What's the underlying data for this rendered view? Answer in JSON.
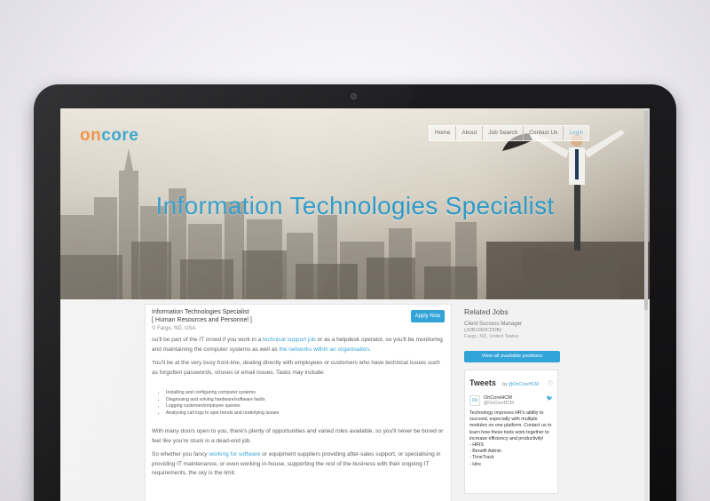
{
  "brand": {
    "logo_prefix": "on",
    "logo_rest": "core",
    "accent": "#2fa0c9",
    "logo_accent": "#f08a3c",
    "button_color": "#32a4d8"
  },
  "nav": {
    "items": [
      "Home",
      "About",
      "Job Search",
      "Contact Us",
      "Login"
    ]
  },
  "hero": {
    "title": "Information Technologies Specialist"
  },
  "job": {
    "title": "Information Technologies Specialist",
    "category": "[ Human Resources and Personnel ]",
    "location_icon": "map-pin-icon",
    "location": "Fargo, ND, USA",
    "apply_label": "Apply Now",
    "p1_a": "ou'll be part of the IT crowd if you work in a ",
    "p1_link1": "technical support job",
    "p1_b": " or as a helpdesk operator, so you'll be monitoring and maintaining the computer systems as well as ",
    "p1_link2": "the networks within an organisation",
    "p1_c": ".",
    "p2": "You'll be at the very busy front-line, dealing directly with employees or customers who have technical issues such as forgotten passwords, viruses or email issues. Tasks may include:",
    "tasks": [
      "Installing and configuring computer systems",
      "Diagnosing and solving hardware/software faults",
      "Logging customer/employee queries",
      "Analysing call logs to spot trends and underlying issues"
    ],
    "p3": "With many doors open to you, there's plenty of opportunities and varied roles available, so you'll never be bored or feel like you're stuck in a dead-end job.",
    "p4_a": "So whether you fancy ",
    "p4_link": "working for software",
    "p4_b": " or equipment suppliers providing after-sales support, or specialising in providing IT maintenance, or even working in-house, supporting the rest of the business with their ongoing IT requirements, the sky is the limit."
  },
  "sidebar": {
    "related_heading": "Related Jobs",
    "related": {
      "title": "Client Success Manager",
      "id": "(JOB1059CDDB)",
      "location": "Fargo, ND, United States"
    },
    "view_all_label": "View all available positions",
    "tweets": {
      "heading": "Tweets",
      "by_prefix": "by",
      "by_handle": "@OnCoreHCM",
      "account_name": "OnCoreHCM",
      "account_handle": "@OnCoreHCM",
      "avatar_text": "On",
      "text_lines": [
        "Technology improves HR's ability to succeed, especially with multiple modules on one platform. Contact us to learn how these tools work together to increase efficiency and productivity!",
        "- HRIS",
        "- Benefit Admin",
        "- TimeTrack",
        "- Hire"
      ]
    }
  },
  "icons": {
    "info": "info-icon",
    "twitter": "twitter-bird-icon",
    "pin": "map-pin-icon"
  }
}
